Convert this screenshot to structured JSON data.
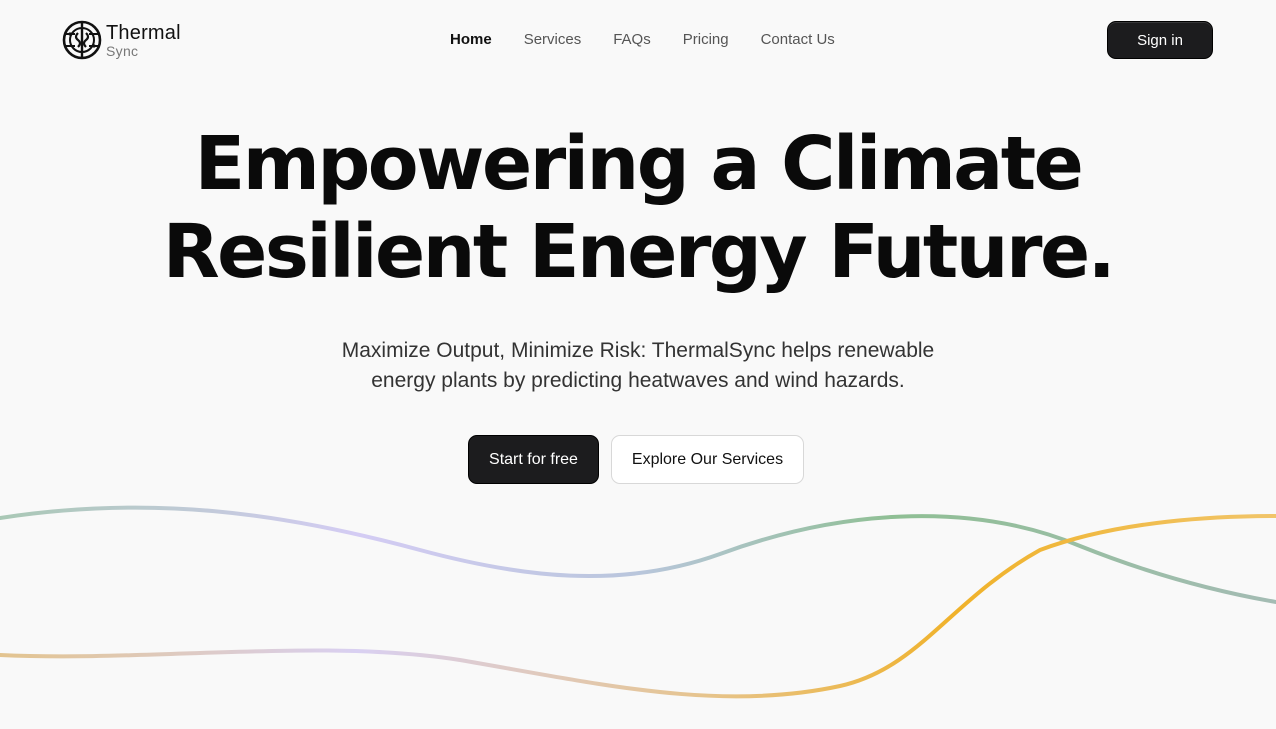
{
  "brand": {
    "name_line1": "Thermal",
    "name_line2": "Sync",
    "logo_icon": "thermalsync-logo-icon"
  },
  "nav": {
    "items": [
      {
        "label": "Home",
        "active": true
      },
      {
        "label": "Services",
        "active": false
      },
      {
        "label": "FAQs",
        "active": false
      },
      {
        "label": "Pricing",
        "active": false
      },
      {
        "label": "Contact Us",
        "active": false
      }
    ],
    "signin_label": "Sign in"
  },
  "hero": {
    "title_line1": "Empowering a Climate",
    "title_line2": "Resilient Energy Future.",
    "subtitle_line1": "Maximize Output, Minimize Risk: ThermalSync helps renewable",
    "subtitle_line2": "energy plants by predicting heatwaves and wind hazards.",
    "primary_cta": "Start for free",
    "secondary_cta": "Explore Our Services"
  },
  "colors": {
    "background": "#f9f9f9",
    "button_dark": "#1c1c1e",
    "wave_green": "#8fbf94",
    "wave_lavender": "#d4ccf4",
    "wave_gold": "#f0b22a",
    "wave_tan": "#e3c48f"
  }
}
